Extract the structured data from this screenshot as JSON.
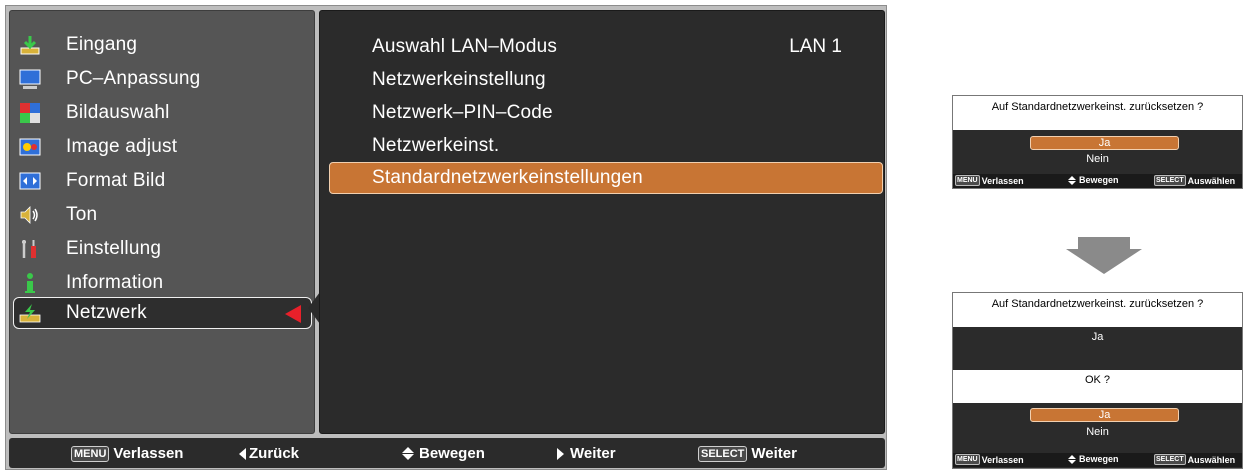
{
  "left_menu": {
    "items": [
      {
        "label": "Eingang",
        "icon": "input-icon"
      },
      {
        "label": "PC–Anpassung",
        "icon": "pc-adjust-icon"
      },
      {
        "label": "Bildauswahl",
        "icon": "image-select-icon"
      },
      {
        "label": "Image adjust",
        "icon": "image-adjust-icon"
      },
      {
        "label": "Format Bild",
        "icon": "screen-format-icon"
      },
      {
        "label": "Ton",
        "icon": "sound-icon"
      },
      {
        "label": "Einstellung",
        "icon": "setting-icon"
      },
      {
        "label": "Information",
        "icon": "information-icon"
      },
      {
        "label": "Netzwerk",
        "icon": "network-icon"
      }
    ],
    "selected": "Netzwerk"
  },
  "submenu": {
    "items": [
      {
        "label": "Auswahl LAN–Modus",
        "value": "LAN 1"
      },
      {
        "label": "Netzwerkeinstellung",
        "value": ""
      },
      {
        "label": "Netzwerk–PIN–Code",
        "value": ""
      },
      {
        "label": "Netzwerkeinst.",
        "value": ""
      },
      {
        "label": "Standardnetzwerkeinstellungen",
        "value": ""
      }
    ],
    "selected": "Standardnetzwerkeinstellungen"
  },
  "footer": {
    "exit_key": "MENU",
    "exit_label": "Verlassen",
    "back_label": "Zurück",
    "move_label": "Bewegen",
    "next_label": "Weiter",
    "select_key": "SELECT",
    "select_label": "Weiter"
  },
  "dialog1": {
    "question": "Auf Standardnetzwerkeinst. zurücksetzen ?",
    "yes": "Ja",
    "no": "Nein",
    "foot": {
      "exit_key": "MENU",
      "exit": "Verlassen",
      "move": "Bewegen",
      "select_key": "SELECT",
      "select": "Auswählen"
    }
  },
  "dialog2": {
    "question": "Auf Standardnetzwerkeinst. zurücksetzen ?",
    "answer": "Ja",
    "confirm": "OK ?",
    "yes": "Ja",
    "no": "Nein",
    "foot": {
      "exit_key": "MENU",
      "exit": "Verlassen",
      "move": "Bewegen",
      "select_key": "SELECT",
      "select": "Auswählen"
    }
  },
  "colors": {
    "highlight": "#c87534",
    "panel_dark": "#2b2b2b",
    "panel_mid": "#555555",
    "frame": "#bdbdbd",
    "pointer_red": "#e8202a"
  }
}
